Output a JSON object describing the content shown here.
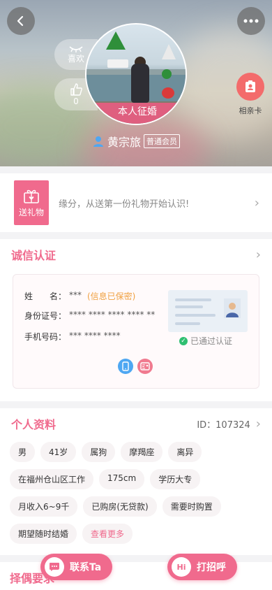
{
  "hero": {
    "like_label": "喜欢",
    "thumb_count": "0",
    "photo_caption": "本人征婚",
    "name": "黄宗旅",
    "member_badge": "普通会员",
    "card_label": "相亲卡"
  },
  "gift": {
    "tile_label": "送礼物",
    "prompt": "缘分，从送第一份礼物开始认识!"
  },
  "credit": {
    "title": "诚信认证",
    "name_label": "姓　　名：",
    "name_value": "***",
    "name_secret": "(信息已保密)",
    "id_label": "身份证号：",
    "id_value": "**** **** **** **** **",
    "phone_label": "手机号码：",
    "phone_value": "*** **** ****",
    "verified_text": "已通过认证"
  },
  "personal": {
    "title": "个人资料",
    "id_text": "ID：107324",
    "tags": [
      "男",
      "41岁",
      "属狗",
      "摩羯座",
      "离异",
      "在福州仓山区工作",
      "175cm",
      "学历大专",
      "月收入6~9千",
      "已购房(无贷款)",
      "需要时购置",
      "期望随时结婚"
    ],
    "more_label": "查看更多"
  },
  "partner": {
    "title": "择偶要求"
  },
  "actions": {
    "contact_label": "联系Ta",
    "hello_icon": "Hi",
    "hello_label": "打招呼"
  },
  "colors": {
    "accent": "#f06a8d",
    "coral": "#f36b6b",
    "verified_green": "#2fbf71",
    "secret_orange": "#f0a040"
  }
}
